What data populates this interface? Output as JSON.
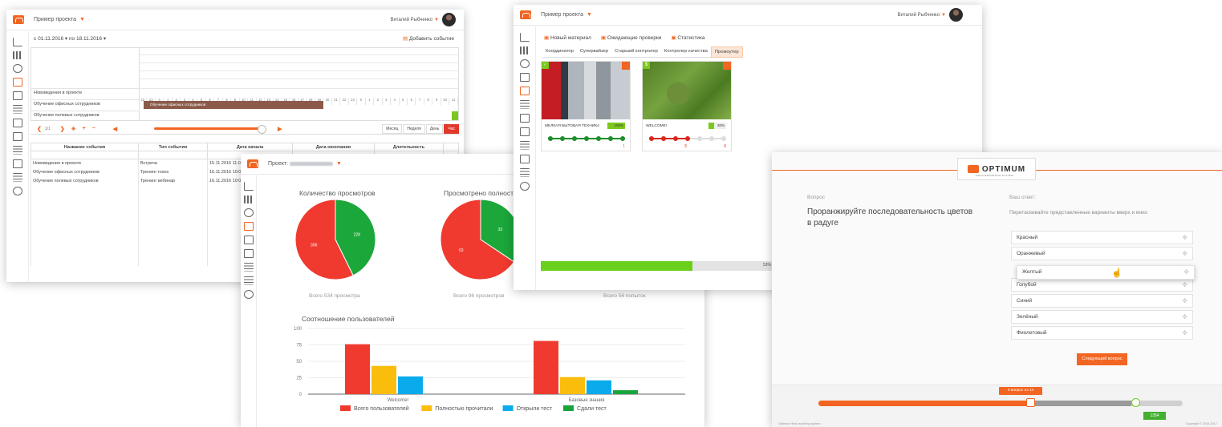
{
  "calendar_window": {
    "project_label": "Пример проекта",
    "user_name": "Виталий Рыбченко",
    "date_from_label": "с",
    "date_from": "01.11.2016",
    "date_to_label": "по",
    "date_to": "18.11.2016",
    "add_event": "Добавить событие",
    "gantt_rows": [
      "Нововедения в проекте",
      "Обучение офисных сотрудников",
      "Обучение полевых сотрудников"
    ],
    "gantt_bar_label": "Обучение офисных сотрудников",
    "hour_ticks": [
      "22",
      "23",
      "0",
      "1",
      "2",
      "3",
      "4",
      "5",
      "6",
      "7",
      "8",
      "9",
      "10",
      "11",
      "12",
      "13",
      "14",
      "15",
      "16",
      "17",
      "18",
      "19",
      "20",
      "21",
      "22",
      "23",
      "0",
      "1",
      "2",
      "3",
      "4",
      "5",
      "6",
      "7",
      "8",
      "9",
      "10",
      "11"
    ],
    "pager_text": "1/1",
    "view_buttons": [
      "Месяц",
      "Неделя",
      "День",
      "Час"
    ],
    "table_headers": [
      "Название события",
      "Тип события",
      "Дата начала",
      "Дата окончания",
      "Длительность"
    ],
    "table_rows": [
      [
        "Нововедения в проекте",
        "Встреча",
        "15.11.2016 11:00"
      ],
      [
        "Обучение офисных сотрудников",
        "Тренинг roses",
        "16.11.2016 10:00"
      ],
      [
        "Обучение полевых сотрудников",
        "Тренинг вебинар",
        "16.11.2016 10:00"
      ]
    ]
  },
  "stats_window": {
    "project_label": "Проект:",
    "pie1_title": "Количество просмотров",
    "pie1_caption": "Всего 534 просмотра",
    "pie2_title": "Просмотрено полностью",
    "pie2_caption": "Всего 96 просмотров",
    "pie3_caption": "Всего 56 попыток",
    "bar_title": "Соотношение пользователей"
  },
  "materials_window": {
    "project_label": "Пример проекта",
    "user_name": "Виталий Рыбченко",
    "nav": [
      "Новый материал",
      "Ожидающие проверки",
      "Статистика"
    ],
    "tabs": [
      "Координатор",
      "Супервайзер",
      "Старший контролер",
      "Контролер качества",
      "Промоутер"
    ],
    "card1": {
      "name": "МЕЛКАЯ БЫТОВАЯ ТЕХНИКА",
      "percent": "100%",
      "count": "1"
    },
    "card2": {
      "name": "WELCOME!",
      "percent": "30%",
      "count1": "3",
      "count2": "6"
    },
    "progress_text": "53%",
    "progress_value": 0.65
  },
  "quiz_window": {
    "brand": "OPTIMUM",
    "brand_sub": "FIELD REPORTING SYSTEM",
    "question_label": "Вопрос",
    "question_text": "Проранжируйте последовательность цветов в радуге",
    "answer_label": "Ваш ответ:",
    "answer_hint": "Перетаскивайте представленные варианты вверх и вниз",
    "options": [
      "Красный",
      "Оранжевый",
      "Голубой",
      "Синий",
      "Зелёный",
      "Фиолетовый"
    ],
    "dragged_option": "Желтый",
    "next_button": "Следующий вопрос",
    "progress_tip": "8 вопрос из 14",
    "timer": "1354",
    "footer_left": "Optimum field reporting system",
    "footer_right": "Copyright © 2016-2017"
  },
  "chart_data": [
    {
      "type": "pie",
      "title": "Количество просмотров",
      "labels": [
        "green",
        "red"
      ],
      "values": [
        228,
        306
      ],
      "colors": [
        "#1ba73a",
        "#f03a2f"
      ]
    },
    {
      "type": "pie",
      "title": "Просмотрено полностью",
      "labels": [
        "green",
        "red"
      ],
      "values": [
        33,
        63
      ],
      "colors": [
        "#1ba73a",
        "#f03a2f"
      ]
    },
    {
      "type": "bar",
      "title": "Соотношение пользователей",
      "categories": [
        "Welcome!",
        "Базовые знания"
      ],
      "series": [
        {
          "name": "Всего пользователей",
          "values": [
            76,
            81
          ],
          "color": "#f03a2f"
        },
        {
          "name": "Полностью прочитали",
          "values": [
            43,
            26
          ],
          "color": "#fbbd0c"
        },
        {
          "name": "Открыли тест",
          "values": [
            27,
            21
          ],
          "color": "#0aabec"
        },
        {
          "name": "Сдали тест",
          "values": [
            0,
            6
          ],
          "color": "#17a43c"
        }
      ],
      "ylim": [
        0,
        100
      ],
      "yticks": [
        0,
        25,
        50,
        75,
        100
      ],
      "legend": "bottom"
    }
  ]
}
